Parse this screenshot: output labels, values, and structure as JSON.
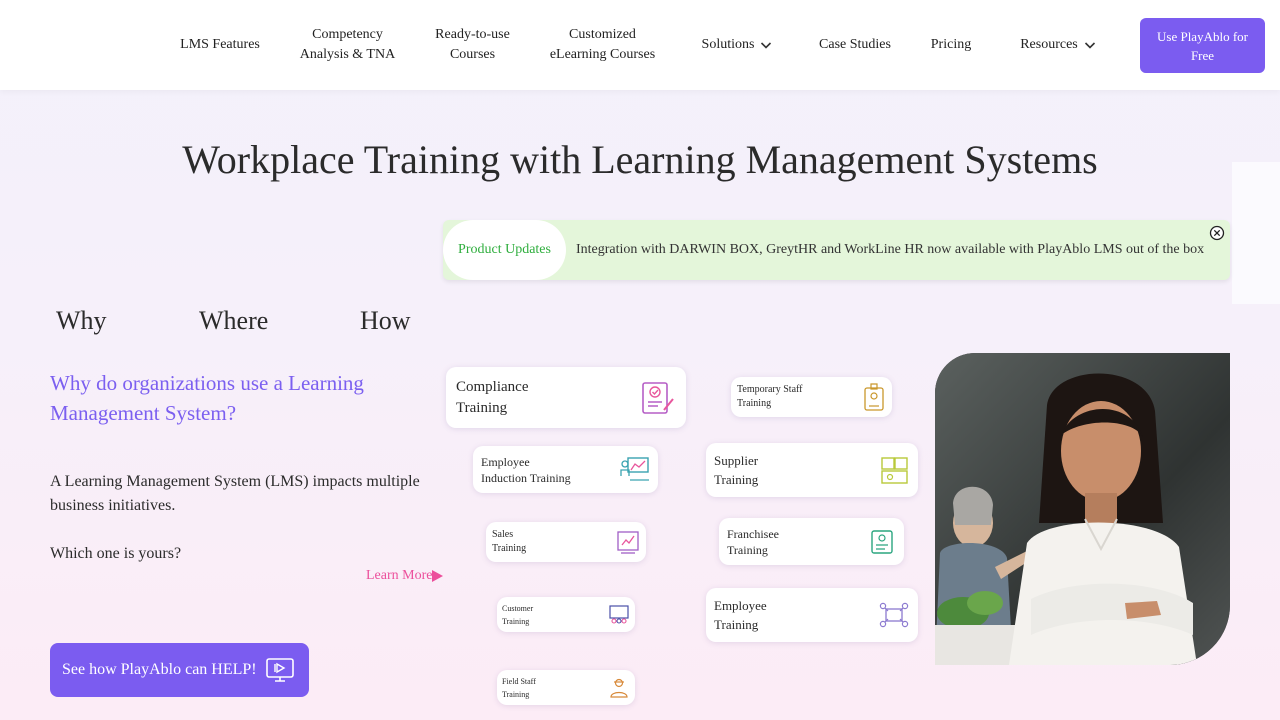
{
  "nav": {
    "items": [
      {
        "label": "LMS Features"
      },
      {
        "label": "Competency\nAnalysis & TNA"
      },
      {
        "label": "Ready-to-use\nCourses"
      },
      {
        "label": "Customized\neLearning Courses"
      },
      {
        "label": "Solutions"
      },
      {
        "label": "Case Studies"
      },
      {
        "label": "Pricing"
      },
      {
        "label": "Resources"
      }
    ],
    "cta_label": "Use PlayAblo for Free"
  },
  "page_title": "Workplace Training with Learning Management Systems",
  "announcement": {
    "tag": "Product Updates",
    "text": "Integration with DARWIN BOX, GreytHR and WorkLine HR now available with PlayAblo LMS out of the box"
  },
  "tabs": [
    {
      "label": "Why"
    },
    {
      "label": "Where"
    },
    {
      "label": "How"
    }
  ],
  "left": {
    "heading": "Why do organizations use a Learning Management System?",
    "para1": "A Learning Management System (LMS) impacts multiple business initiatives.",
    "para2": "Which one is yours?",
    "learn_more": "Learn More",
    "help_button": "See how PlayAblo can HELP!"
  },
  "cards": [
    {
      "label": "Compliance\nTraining"
    },
    {
      "label": "Employee\nInduction Training"
    },
    {
      "label": "Sales\nTraining"
    },
    {
      "label": "Customer\nTraining"
    },
    {
      "label": "Field Staff\nTraining"
    },
    {
      "label": "Temporary Staff\nTraining"
    },
    {
      "label": "Supplier\nTraining"
    },
    {
      "label": "Franchisee\nTraining"
    },
    {
      "label": "Employee\nTraining"
    }
  ],
  "colors": {
    "accent": "#7b5cf0",
    "pink": "#ec4f9c",
    "green": "#2fae3e",
    "announce_bg": "#e4f6da"
  }
}
